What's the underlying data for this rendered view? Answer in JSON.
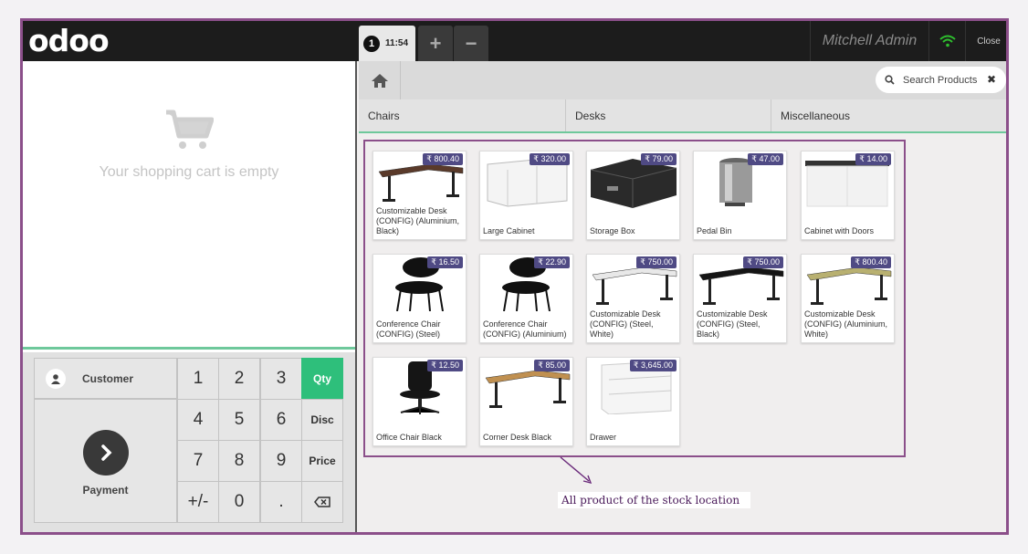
{
  "topbar": {
    "logo": "odoo",
    "order_number": "1",
    "order_time": "11:54",
    "add_tab": "+",
    "remove_tab": "−",
    "user": "Mitchell Admin",
    "close": "Close"
  },
  "cart": {
    "empty_message": "Your shopping cart is empty"
  },
  "numpad": {
    "customer": "Customer",
    "payment": "Payment",
    "keys": [
      "1",
      "2",
      "3",
      "4",
      "5",
      "6",
      "7",
      "8",
      "9",
      "+/-",
      "0",
      "."
    ],
    "modes": [
      "Qty",
      "Disc",
      "Price"
    ]
  },
  "search": {
    "placeholder": "Search Products",
    "clear": "✖"
  },
  "categories": [
    "Chairs",
    "Desks",
    "Miscellaneous"
  ],
  "products": [
    {
      "name": "Customizable Desk (CONFIG) (Aluminium, Black)",
      "price": "₹ 800.40",
      "kind": "desk",
      "color": "#5a3a2a"
    },
    {
      "name": "Large Cabinet",
      "price": "₹ 320.00",
      "kind": "cabinet",
      "color": "#f4f4f4"
    },
    {
      "name": "Storage Box",
      "price": "₹ 79.00",
      "kind": "box",
      "color": "#2a2a2a"
    },
    {
      "name": "Pedal Bin",
      "price": "₹ 47.00",
      "kind": "bin",
      "color": "#9a9a9a"
    },
    {
      "name": "Cabinet with Doors",
      "price": "₹ 14.00",
      "kind": "cabinet2",
      "color": "#f2f2f2"
    },
    {
      "name": "Conference Chair (CONFIG) (Steel)",
      "price": "₹ 16.50",
      "kind": "chair",
      "color": "#111111"
    },
    {
      "name": "Conference Chair (CONFIG) (Aluminium)",
      "price": "₹ 22.90",
      "kind": "chair",
      "color": "#111111"
    },
    {
      "name": "Customizable Desk (CONFIG) (Steel, White)",
      "price": "₹ 750.00",
      "kind": "desk",
      "color": "#e8e8e8"
    },
    {
      "name": "Customizable Desk (CONFIG) (Steel, Black)",
      "price": "₹ 750.00",
      "kind": "desk",
      "color": "#151515"
    },
    {
      "name": "Customizable Desk (CONFIG) (Aluminium, White)",
      "price": "₹ 800.40",
      "kind": "desk",
      "color": "#b8b070"
    },
    {
      "name": "Office Chair Black",
      "price": "₹ 12.50",
      "kind": "office",
      "color": "#151515"
    },
    {
      "name": "Corner Desk Black",
      "price": "₹ 85.00",
      "kind": "desk",
      "color": "#c09050"
    },
    {
      "name": "Drawer",
      "price": "₹ 3,645.00",
      "kind": "drawer",
      "color": "#f5f5f5"
    }
  ],
  "annotation": "All product of the stock location",
  "colors": {
    "accent": "#2ebf7b",
    "price_tag": "#4f4a84",
    "frame": "#8b4f8a"
  }
}
